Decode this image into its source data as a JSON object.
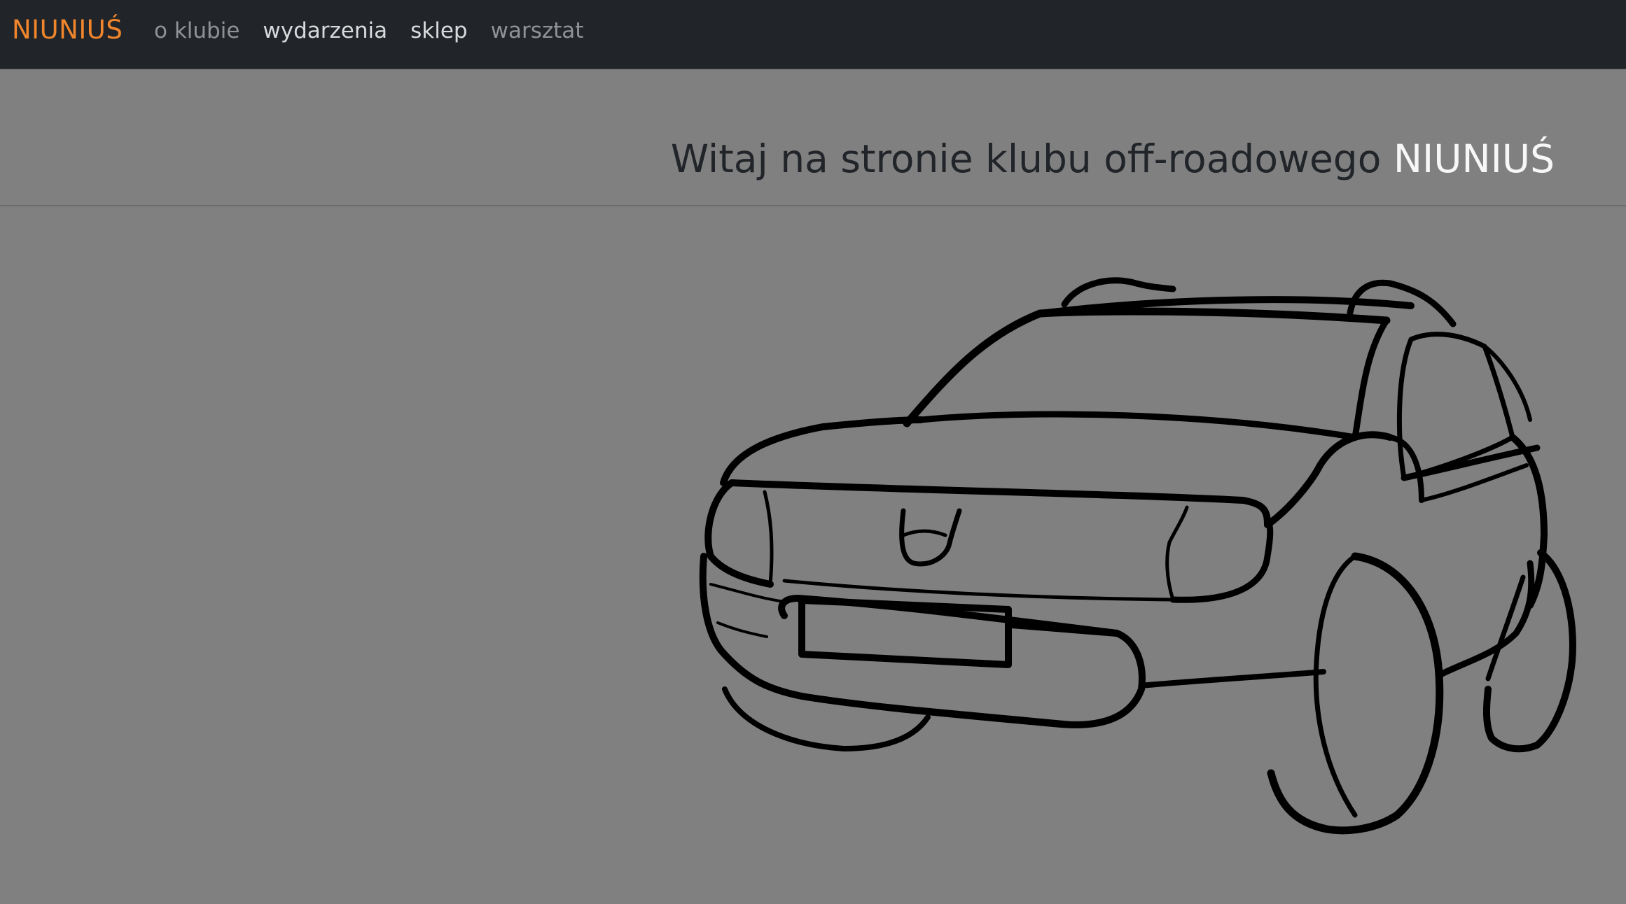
{
  "navbar": {
    "brand": "NIUNIUŚ",
    "links": [
      {
        "label": "o klubie",
        "state": "muted"
      },
      {
        "label": "wydarzenia",
        "state": "active"
      },
      {
        "label": "sklep",
        "state": "active"
      },
      {
        "label": "warsztat",
        "state": "muted"
      }
    ]
  },
  "hero": {
    "welcome_text": "Witaj na stronie klubu off-roadowego",
    "club_name": "NIUNIUŚ"
  },
  "colors": {
    "navbar_bg": "#212529",
    "brand": "#f0852b",
    "page_bg": "#808080",
    "heading": "#212529",
    "club_name": "#f7f7f7"
  },
  "icons": {
    "illustration": "suv-car-outline"
  }
}
